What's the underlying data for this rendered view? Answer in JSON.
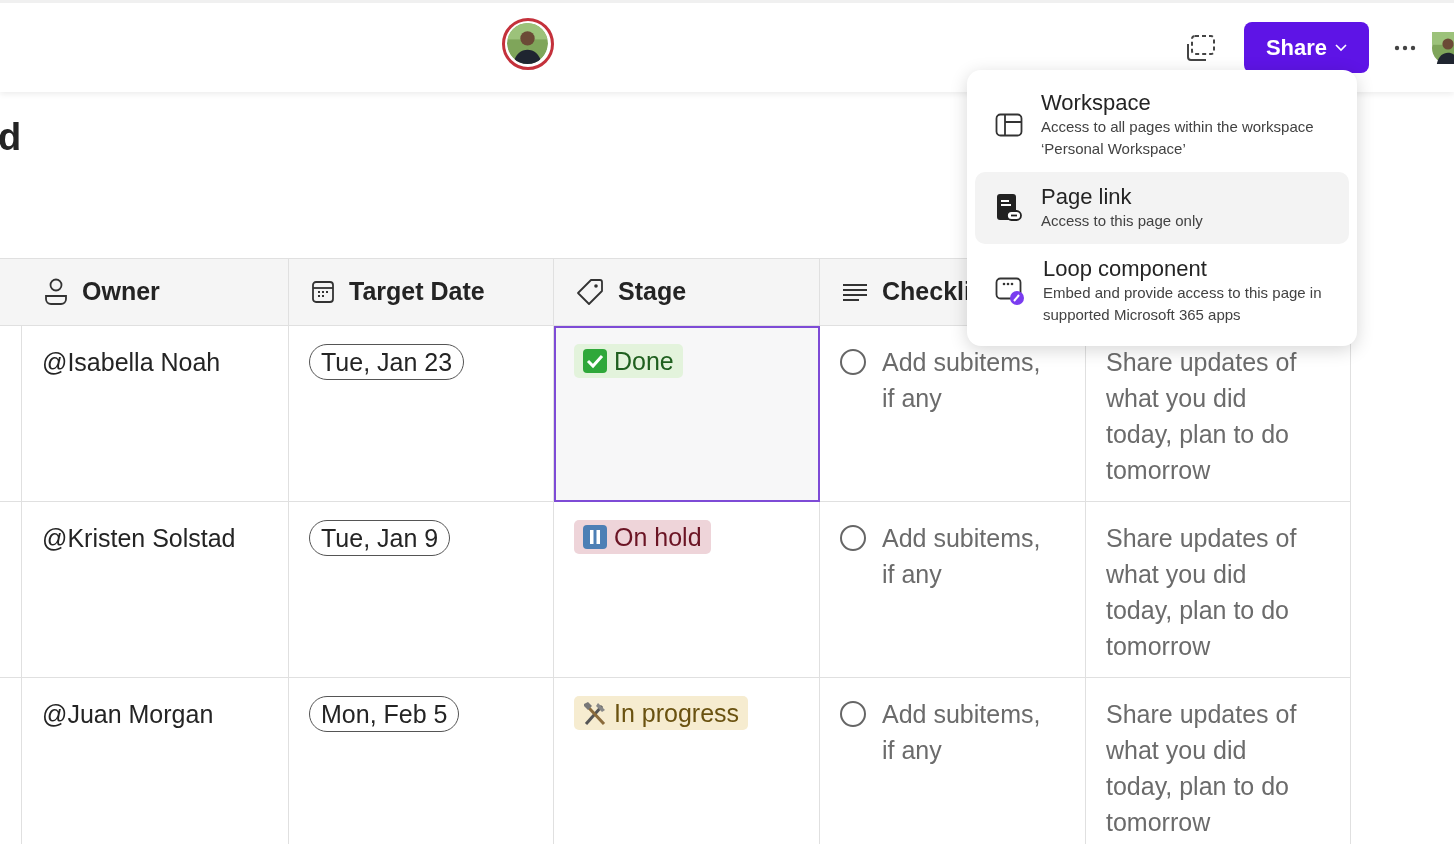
{
  "toolbar": {
    "share_button": "Share"
  },
  "page_title": "d",
  "share_menu": {
    "items": [
      {
        "kind": "workspace",
        "title": "Workspace",
        "description": "Access to all pages within the workspace ‘Personal Workspace’",
        "selected": false
      },
      {
        "kind": "page_link",
        "title": "Page link",
        "description": "Access to this page only",
        "selected": true
      },
      {
        "kind": "loop",
        "title": "Loop component",
        "description": "Embed and provide access to this page in supported Microsoft 365 apps",
        "selected": false
      }
    ]
  },
  "table": {
    "columns": [
      {
        "kind": "person",
        "label": "Owner"
      },
      {
        "kind": "date",
        "label": "Target Date"
      },
      {
        "kind": "tag",
        "label": "Stage"
      },
      {
        "kind": "text",
        "label": "Checkli"
      }
    ],
    "rows": [
      {
        "owner": "@Isabella Noah",
        "target_date": "Tue, Jan 23",
        "stage": {
          "kind": "done",
          "label": "Done",
          "color": "#e3f3dc"
        },
        "stage_selected": true,
        "checklist": {
          "text": "Add subitems, if any",
          "checked": false
        },
        "column_5": "Share updates of what you did today, plan to do tomorrow"
      },
      {
        "owner": "@Kristen Solstad",
        "target_date": "Tue, Jan 9",
        "stage": {
          "kind": "hold",
          "label": "On hold",
          "color": "#eed4d9"
        },
        "stage_selected": false,
        "checklist": {
          "text": "Add subitems, if any",
          "checked": false
        },
        "column_5": "Share updates of what you did today, plan to do tomorrow"
      },
      {
        "owner": "@Juan Morgan",
        "target_date": "Mon, Feb 5",
        "stage": {
          "kind": "progress",
          "label": "In progress",
          "color": "#f6ecd0"
        },
        "stage_selected": false,
        "checklist": {
          "text": "Add subitems, if any",
          "checked": false
        },
        "column_5": "Share updates of what you did today, plan to do tomorrow"
      }
    ]
  }
}
